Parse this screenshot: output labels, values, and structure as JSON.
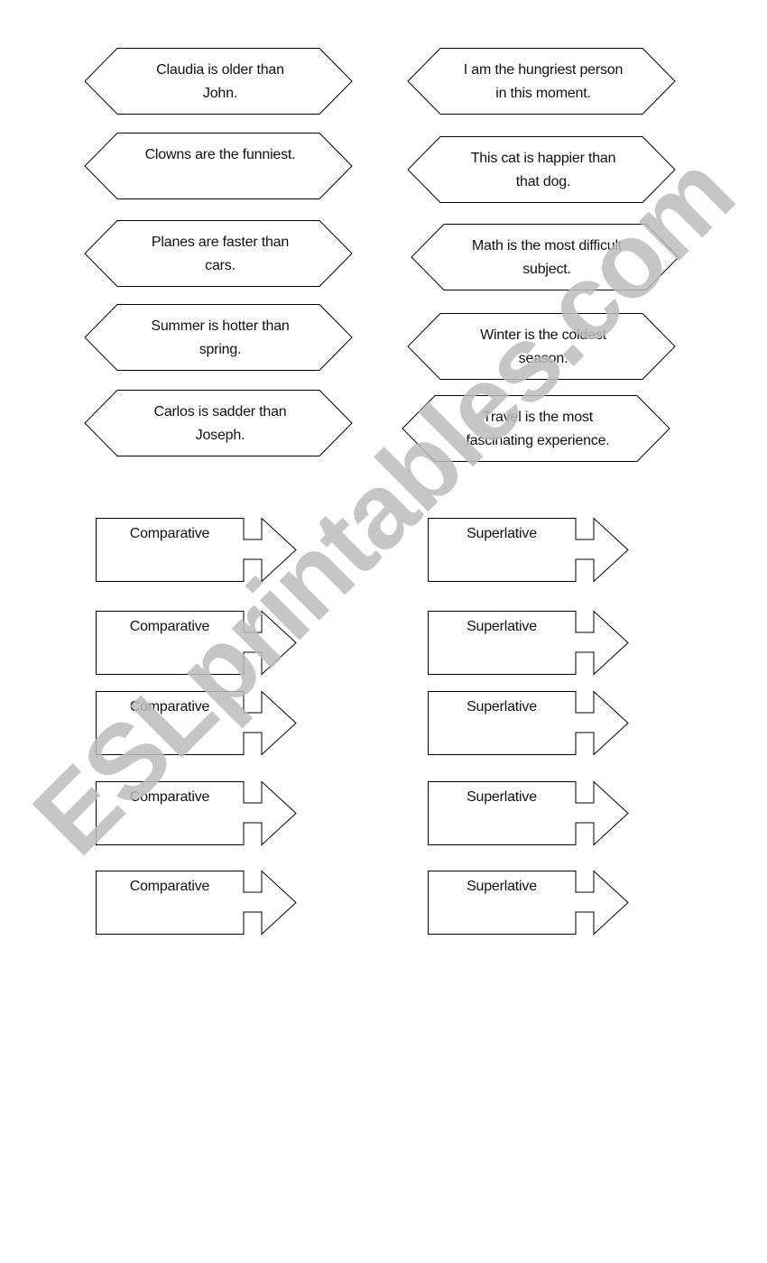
{
  "worksheet": {
    "sentences_left": [
      "Claudia is older than John.",
      "Clowns are the funniest.",
      "Planes are faster than cars.",
      "Summer is hotter than spring.",
      "Carlos is sadder than Joseph."
    ],
    "sentences_right": [
      "I am the hungriest person in this moment.",
      "This cat is happier than that dog.",
      "Math is the most difficult subject.",
      "Winter is the coldest season.",
      "Travel is the most fascinating experience."
    ],
    "arrows_left": [
      "Comparative",
      "Comparative",
      "Comparative",
      "Comparative",
      "Comparative"
    ],
    "arrows_right": [
      "Superlative",
      "Superlative",
      "Superlative",
      "Superlative",
      "Superlative"
    ],
    "watermark": "ESLprintables.com",
    "colors": {
      "stroke": "#000000",
      "text": "#111111",
      "watermark": "#bdbdbd",
      "background": "#ffffff"
    }
  }
}
